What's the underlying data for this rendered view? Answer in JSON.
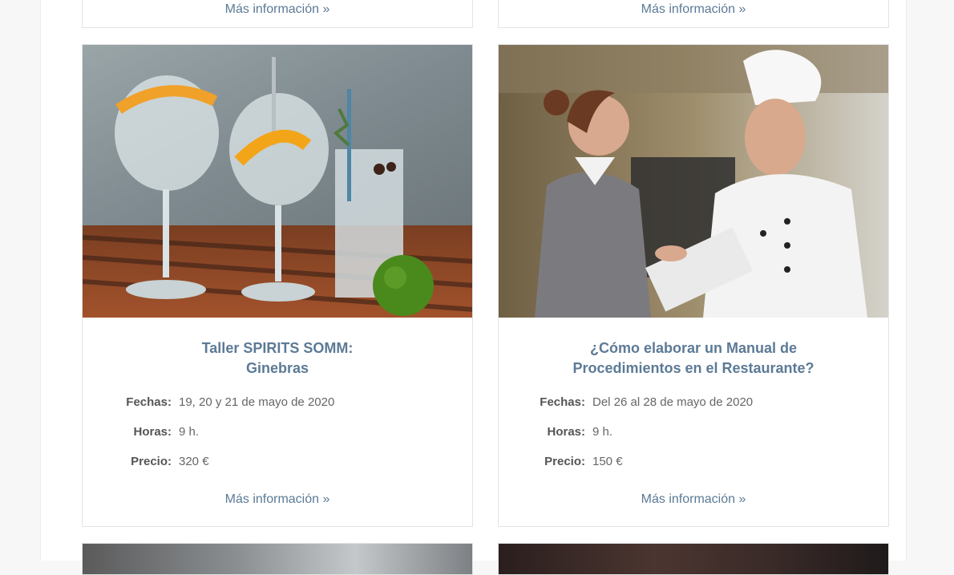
{
  "more_label": "Más información »",
  "cards": [
    {
      "title_line1": "Taller SPIRITS SOMM:",
      "title_line2": "Ginebras",
      "fechas_label": "Fechas:",
      "fechas_value": "19, 20 y 21 de mayo de 2020",
      "horas_label": "Horas:",
      "horas_value": "9 h.",
      "precio_label": "Precio:",
      "precio_value": "320 €",
      "image": "gin-tonic-glasses-photo"
    },
    {
      "title_line1": "¿Cómo elaborar un Manual de",
      "title_line2": "Procedimientos en el Restaurante?",
      "fechas_label": "Fechas:",
      "fechas_value": "Del 26 al 28 de mayo de 2020",
      "horas_label": "Horas:",
      "horas_value": "9 h.",
      "precio_label": "Precio:",
      "precio_value": "150 €",
      "image": "chef-and-manager-kitchen-photo"
    }
  ]
}
